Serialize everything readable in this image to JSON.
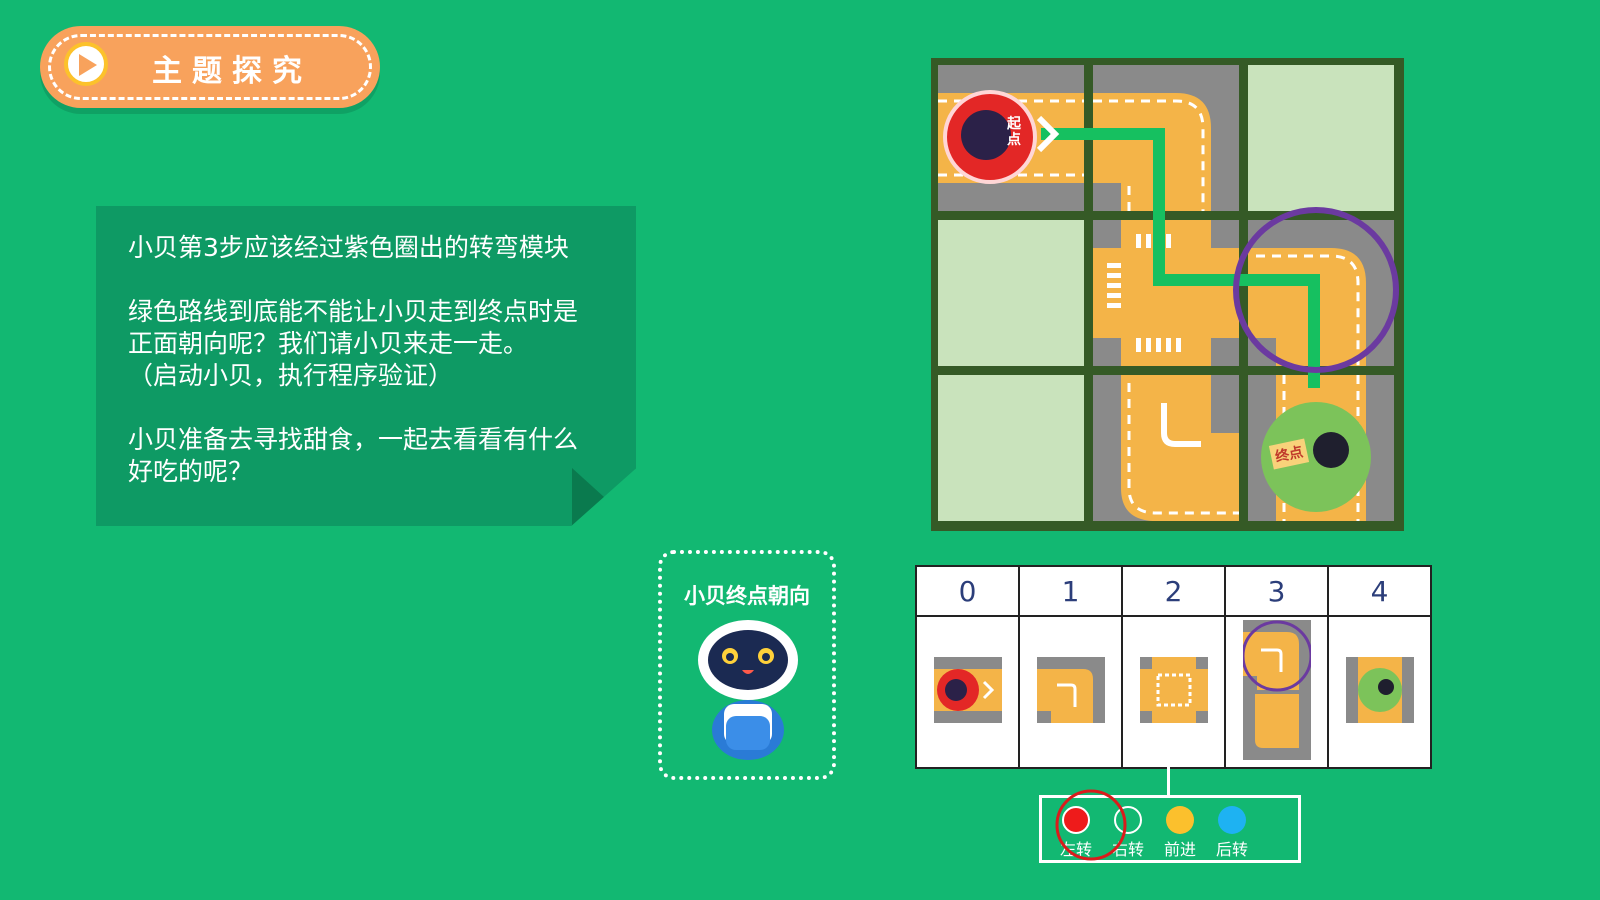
{
  "header": {
    "title": "主题探究"
  },
  "instructions": {
    "line1": "小贝第3步应该经过紫色圈出的转弯模块",
    "line2a": "绿色路线到底能不能让小贝走到终点时是",
    "line2b": "正面朝向呢？我们请小贝来走一走。",
    "line2c": "（启动小贝，执行程序验证）",
    "line3a": "小贝准备去寻找甜食，一起去看看有什么",
    "line3b": "好吃的呢？"
  },
  "map": {
    "start_label": "起点",
    "end_label": "终点"
  },
  "robot_panel": {
    "title": "小贝终点朝向"
  },
  "steps": {
    "headers": [
      "0",
      "1",
      "2",
      "3",
      "4"
    ]
  },
  "legend": {
    "items": [
      {
        "label": "左转",
        "color": "#ee1b1b"
      },
      {
        "label": "右转",
        "color": "#12b872"
      },
      {
        "label": "前进",
        "color": "#fbc02d"
      },
      {
        "label": "后转",
        "color": "#1eb2f2"
      }
    ]
  },
  "colors": {
    "background": "#12b872",
    "road": "#f4b448",
    "highlight": "#6b3aa0",
    "path": "#16c060"
  }
}
